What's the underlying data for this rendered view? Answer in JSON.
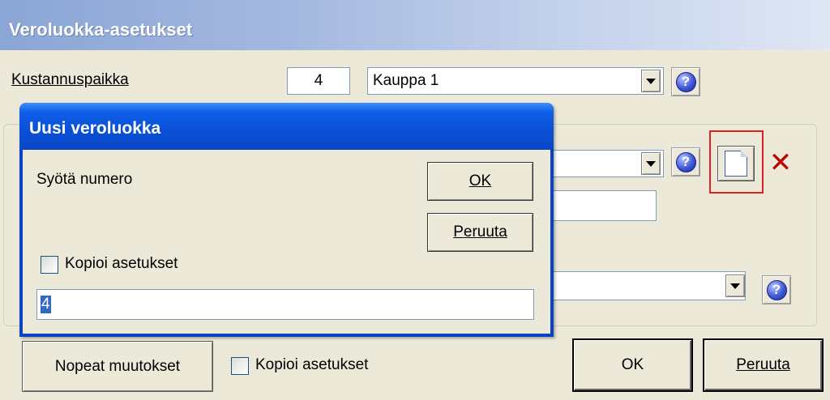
{
  "window": {
    "title": "Veroluokka-asetukset"
  },
  "cost_center": {
    "label": "Kustannuspaikka",
    "number": "4",
    "selected": "Kauppa 1"
  },
  "footer": {
    "quick_changes_label": "Nopeat muutokset",
    "copy_settings_label": "Kopioi asetukset",
    "ok_label": "OK",
    "cancel_label": "Peruuta"
  },
  "dialog": {
    "title": "Uusi veroluokka",
    "prompt": "Syötä numero",
    "ok_label": "OK",
    "cancel_label": "Peruuta",
    "copy_settings_label": "Kopioi asetukset",
    "number_value": "4"
  },
  "icons": {
    "help": "help-icon",
    "new": "new-document-icon",
    "delete": "delete-x-icon",
    "dropdown": "chevron-down-icon"
  },
  "colors": {
    "dialog_title": "#0a4fd6",
    "highlight_border": "#e02020",
    "delete": "#c00000"
  }
}
